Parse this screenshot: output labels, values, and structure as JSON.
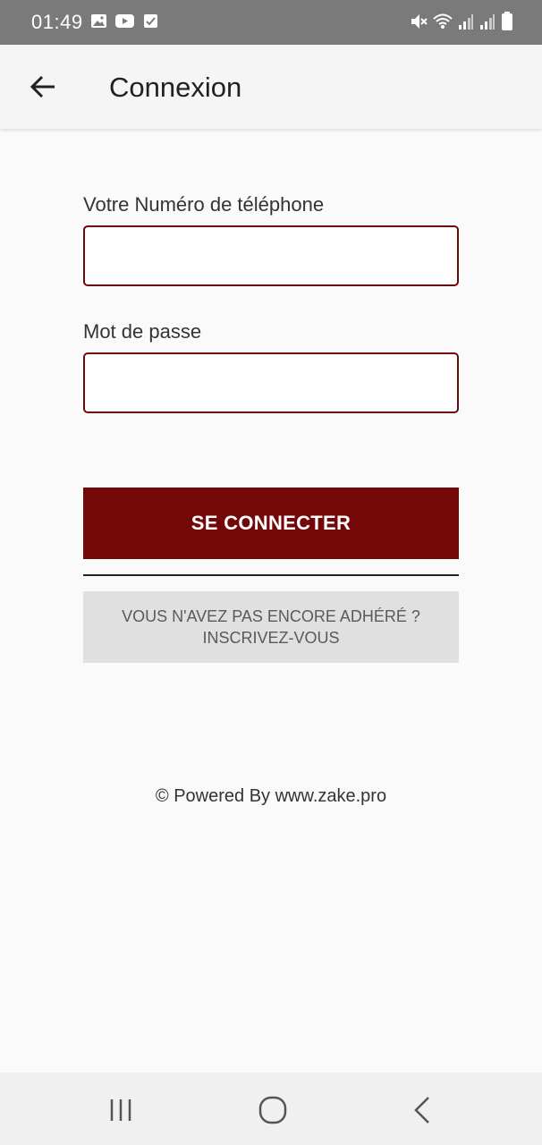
{
  "status_bar": {
    "time": "01:49",
    "left_icons": [
      "image-icon",
      "youtube-icon",
      "checkbox-icon"
    ],
    "right_icons": [
      "mute-icon",
      "wifi-icon",
      "signal-icon",
      "signal-icon",
      "battery-icon"
    ]
  },
  "app_bar": {
    "title": "Connexion",
    "back_icon": "arrow-left-icon"
  },
  "form": {
    "phone_label": "Votre Numéro de téléphone",
    "phone_value": "",
    "password_label": "Mot de passe",
    "password_value": ""
  },
  "buttons": {
    "login_label": "SE CONNECTER",
    "register_line1": "VOUS N'AVEZ PAS ENCORE ADHÉRÉ ?",
    "register_line2": "INSCRIVEZ-VOUS"
  },
  "footer": {
    "text": "© Powered By www.zake.pro"
  },
  "nav_bar": {
    "icons": [
      "recent-apps-icon",
      "home-icon",
      "back-icon"
    ]
  },
  "colors": {
    "accent": "#740808",
    "status_bar": "#7a7a7a",
    "secondary_button": "#e0e0e0"
  }
}
